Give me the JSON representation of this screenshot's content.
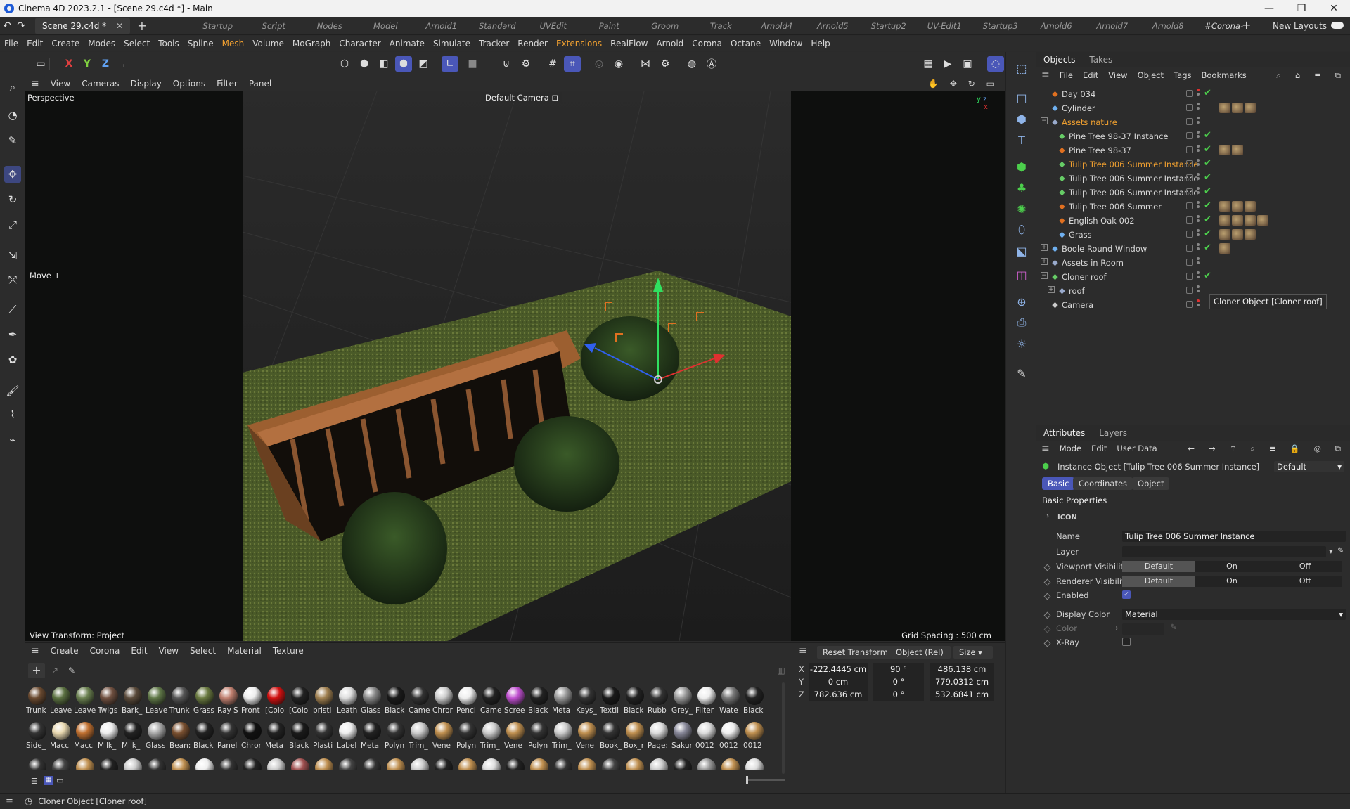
{
  "window": {
    "title": "Cinema 4D 2023.2.1 - [Scene 29.c4d *] - Main",
    "controls": [
      "—",
      "❐",
      "✕"
    ]
  },
  "doc_tab": {
    "label": "Scene 29.c4d *",
    "close": "✕",
    "add": "+"
  },
  "layouts": [
    "Startup",
    "Script",
    "Nodes",
    "Model",
    "Arnold1",
    "Standard",
    "UVEdit",
    "Paint",
    "Groom",
    "Track",
    "Arnold4",
    "Arnold5",
    "Startup2",
    "UV-Edit1",
    "Startup3",
    "Arnold6",
    "Arnold7",
    "Arnold8",
    "#Corona-Standard"
  ],
  "layout_add": "+",
  "new_layouts": "New Layouts",
  "menubar": [
    "File",
    "Edit",
    "Create",
    "Modes",
    "Select",
    "Tools",
    "Spline",
    "Mesh",
    "Volume",
    "MoGraph",
    "Character",
    "Animate",
    "Simulate",
    "Tracker",
    "Render",
    "Extensions",
    "RealFlow",
    "Arnold",
    "Corona",
    "Octane",
    "Window",
    "Help"
  ],
  "toolbar": {
    "axis_x": "X",
    "axis_y": "Y",
    "axis_z": "Z"
  },
  "viewport_menu": [
    "View",
    "Cameras",
    "Display",
    "Options",
    "Filter",
    "Panel"
  ],
  "viewport": {
    "name": "Perspective",
    "camera": "Default Camera",
    "tool_label": "Move",
    "view_transform": "View Transform: Project",
    "grid_spacing": "Grid Spacing : 500 cm"
  },
  "objects_panel": {
    "tabs": [
      "Objects",
      "Takes"
    ],
    "menu": [
      "File",
      "Edit",
      "View",
      "Object",
      "Tags",
      "Bookmarks"
    ],
    "rows": [
      {
        "name": "Day 034",
        "icon": "sun-icon",
        "color": "#e07020",
        "depth": 0,
        "expand": "",
        "check": true,
        "tags": 0,
        "dot": "red"
      },
      {
        "name": "Cylinder",
        "icon": "cylinder-icon",
        "color": "#6fb0f0",
        "depth": 0,
        "expand": "",
        "check": false,
        "tags": 3,
        "dot": ""
      },
      {
        "name": "Assets nature",
        "icon": "null-icon",
        "color": "#9ac",
        "depth": 0,
        "expand": "−",
        "check": false,
        "tags": 0,
        "dot": "",
        "orange": true
      },
      {
        "name": "Pine Tree 98-37 Instance",
        "icon": "instance-icon",
        "color": "#6c6",
        "depth": 1,
        "expand": "",
        "check": true,
        "tags": 0,
        "dot": ""
      },
      {
        "name": "Pine Tree 98-37",
        "icon": "polygon-icon",
        "color": "#e07020",
        "depth": 1,
        "expand": "",
        "check": true,
        "tags": 2,
        "dot": ""
      },
      {
        "name": "Tulip Tree 006 Summer Instance",
        "icon": "instance-icon",
        "color": "#6c6",
        "depth": 1,
        "expand": "",
        "check": true,
        "tags": 0,
        "dot": "",
        "selected": true
      },
      {
        "name": "Tulip Tree 006 Summer Instance",
        "icon": "instance-icon",
        "color": "#6c6",
        "depth": 1,
        "expand": "",
        "check": true,
        "tags": 0,
        "dot": ""
      },
      {
        "name": "Tulip Tree 006 Summer Instance",
        "icon": "instance-icon",
        "color": "#6c6",
        "depth": 1,
        "expand": "",
        "check": true,
        "tags": 0,
        "dot": ""
      },
      {
        "name": "Tulip Tree 006 Summer",
        "icon": "polygon-icon",
        "color": "#e07020",
        "depth": 1,
        "expand": "",
        "check": true,
        "tags": 3,
        "dot": ""
      },
      {
        "name": "English Oak 002",
        "icon": "polygon-icon",
        "color": "#e07020",
        "depth": 1,
        "expand": "",
        "check": true,
        "tags": 4,
        "dot": ""
      },
      {
        "name": "Grass",
        "icon": "grass-icon",
        "color": "#6fb0f0",
        "depth": 1,
        "expand": "",
        "check": true,
        "tags": 3,
        "dot": ""
      },
      {
        "name": "Boole Round Window",
        "icon": "boole-icon",
        "color": "#6fb0f0",
        "depth": 0,
        "expand": "+",
        "check": true,
        "tags": 1,
        "dot": ""
      },
      {
        "name": "Assets in Room",
        "icon": "null-icon",
        "color": "#9ac",
        "depth": 0,
        "expand": "+",
        "check": false,
        "tags": 0,
        "dot": ""
      },
      {
        "name": "Cloner roof",
        "icon": "cloner-icon",
        "color": "#6c6",
        "depth": 0,
        "expand": "−",
        "check": true,
        "tags": 0,
        "dot": ""
      },
      {
        "name": "roof",
        "icon": "null-icon",
        "color": "#9ac",
        "depth": 1,
        "expand": "+",
        "check": false,
        "tags": 0,
        "dot": ""
      },
      {
        "name": "Camera",
        "icon": "camera-icon",
        "color": "#ccc",
        "depth": 0,
        "expand": "",
        "check": false,
        "tags": 0,
        "dot": "red"
      }
    ],
    "tooltip": "Cloner Object [Cloner roof]"
  },
  "attributes_panel": {
    "tabs": [
      "Attributes",
      "Layers"
    ],
    "menu": [
      "Mode",
      "Edit",
      "User Data"
    ],
    "object_title": "Instance Object [Tulip Tree 006 Summer Instance]",
    "mode_dropdown": "Default",
    "subtabs": [
      "Basic",
      "Coordinates",
      "Object"
    ],
    "section": "Basic Properties",
    "icon_row": "ICON",
    "fields": {
      "name_label": "Name",
      "name_value": "Tulip Tree 006 Summer Instance",
      "layer_label": "Layer",
      "viewport_label": "Viewport Visibility",
      "renderer_label": "Renderer Visibility",
      "vis_options": [
        "Default",
        "On",
        "Off"
      ],
      "enabled_label": "Enabled",
      "display_color_label": "Display Color",
      "display_color_value": "Material",
      "color_label": "Color",
      "xray_label": "X-Ray"
    }
  },
  "material_panel": {
    "menu": [
      "Create",
      "Corona",
      "Edit",
      "View",
      "Select",
      "Material",
      "Texture"
    ],
    "row1": [
      {
        "l": "Trunk",
        "c": "#6a4a30"
      },
      {
        "l": "Leave",
        "c": "#5a7040"
      },
      {
        "l": "Leave",
        "c": "#6a8050"
      },
      {
        "l": "Twigs",
        "c": "#705040"
      },
      {
        "l": "Bark_",
        "c": "#5a4a3a"
      },
      {
        "l": "Leave",
        "c": "#607848"
      },
      {
        "l": "Trunk",
        "c": "#555"
      },
      {
        "l": "Grass",
        "c": "#6a7a40"
      },
      {
        "l": "Ray S",
        "c": "#c08070"
      },
      {
        "l": "Front",
        "c": "#eee"
      },
      {
        "l": "[Colo",
        "c": "#d01010"
      },
      {
        "l": "[Colo",
        "c": "#222"
      },
      {
        "l": "bristl",
        "c": "#a08050"
      },
      {
        "l": "Leath",
        "c": "#ddd"
      },
      {
        "l": "Glass",
        "c": "#888"
      },
      {
        "l": "Black",
        "c": "#1a1a1a"
      },
      {
        "l": "Came",
        "c": "#333"
      },
      {
        "l": "Chror",
        "c": "#ccc"
      },
      {
        "l": "Penci",
        "c": "#eee"
      },
      {
        "l": "Came",
        "c": "#222"
      },
      {
        "l": "Scree",
        "c": "#c050d0"
      },
      {
        "l": "Black",
        "c": "#222"
      },
      {
        "l": "Meta",
        "c": "#999"
      },
      {
        "l": "Keys_",
        "c": "#333"
      },
      {
        "l": "Textil",
        "c": "#1a1a1a"
      },
      {
        "l": "Black",
        "c": "#222"
      },
      {
        "l": "Rubb",
        "c": "#333"
      },
      {
        "l": "Grey_",
        "c": "#999"
      },
      {
        "l": "Filter",
        "c": "#eee"
      },
      {
        "l": "Wate",
        "c": "#777"
      },
      {
        "l": "Black",
        "c": "#222"
      }
    ],
    "row2": [
      {
        "l": "Side_",
        "c": "#333"
      },
      {
        "l": "Macc",
        "c": "#e8d8b0"
      },
      {
        "l": "Macc",
        "c": "#c07030"
      },
      {
        "l": "Milk_",
        "c": "#eee"
      },
      {
        "l": "Milk_",
        "c": "#222"
      },
      {
        "l": "Glass",
        "c": "#aaa"
      },
      {
        "l": "Bean:",
        "c": "#7a5030"
      },
      {
        "l": "Black",
        "c": "#222"
      },
      {
        "l": "Panel",
        "c": "#333"
      },
      {
        "l": "Chror",
        "c": "#111"
      },
      {
        "l": "Meta",
        "c": "#222"
      },
      {
        "l": "Black",
        "c": "#1a1a1a"
      },
      {
        "l": "Plasti",
        "c": "#333"
      },
      {
        "l": "Label",
        "c": "#eee"
      },
      {
        "l": "Meta",
        "c": "#222"
      },
      {
        "l": "Polyn",
        "c": "#333"
      },
      {
        "l": "Trim_",
        "c": "#ccc"
      },
      {
        "l": "Vene",
        "c": "#c09050"
      },
      {
        "l": "Polyn",
        "c": "#333"
      },
      {
        "l": "Trim_",
        "c": "#ccc"
      },
      {
        "l": "Vene",
        "c": "#c09050"
      },
      {
        "l": "Polyn",
        "c": "#333"
      },
      {
        "l": "Trim_",
        "c": "#ccc"
      },
      {
        "l": "Vene",
        "c": "#c09050"
      },
      {
        "l": "Book_",
        "c": "#333"
      },
      {
        "l": "Box_r",
        "c": "#c09050"
      },
      {
        "l": "Page:",
        "c": "#ddd"
      },
      {
        "l": "Sakur",
        "c": "#889"
      },
      {
        "l": "0012",
        "c": "#ddd"
      },
      {
        "l": "0012",
        "c": "#eee"
      },
      {
        "l": "0012",
        "c": "#c09050"
      }
    ],
    "row3": [
      "#333",
      "#444",
      "#c09050",
      "#222",
      "#ccc",
      "#333",
      "#c09050",
      "#eee",
      "#333",
      "#222",
      "#ccc",
      "#a05050",
      "#c09050",
      "#444",
      "#333",
      "#c09050",
      "#ccc",
      "#222",
      "#c09050",
      "#ddd",
      "#222",
      "#c09050",
      "#333",
      "#c09050",
      "#444",
      "#c09050",
      "#ccc",
      "#222",
      "#999",
      "#c09050",
      "#ddd"
    ]
  },
  "coord_panel": {
    "reset": "Reset Transform",
    "mode": "Object (Rel)",
    "size_mode": "Size",
    "rows": [
      {
        "axis": "X",
        "pos": "-222.4445 cm",
        "rot": "90 °",
        "size": "486.138 cm"
      },
      {
        "axis": "Y",
        "pos": "0 cm",
        "rot": "0 °",
        "size": "779.0312 cm"
      },
      {
        "axis": "Z",
        "pos": "782.636 cm",
        "rot": "0 °",
        "size": "532.6841 cm"
      }
    ]
  },
  "status": "Cloner Object [Cloner roof]",
  "colors": {
    "accent": "#4a57b8",
    "highlight": "#f0a030",
    "check": "#4ccf4c"
  }
}
